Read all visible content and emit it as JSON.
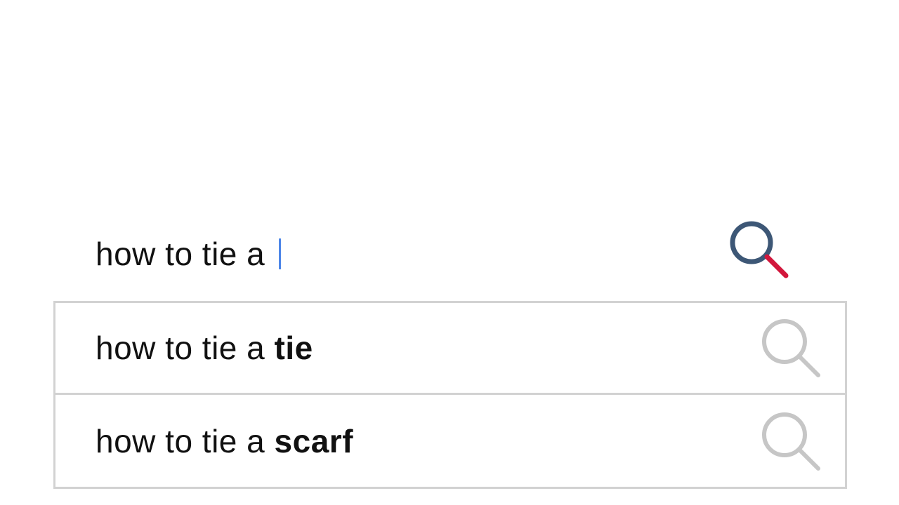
{
  "search": {
    "query": "how to tie a ",
    "colors": {
      "lens": "#3d5776",
      "handle": "#d2173c",
      "caret": "#4d86e8",
      "suggestion_icon": "#c6c6c6",
      "border": "#d2d2d2"
    },
    "button_icon": "magnifier-icon"
  },
  "suggestions": [
    {
      "prefix": "how to tie a ",
      "completion": "tie",
      "icon": "search-icon"
    },
    {
      "prefix": "how to tie a ",
      "completion": "scarf",
      "icon": "search-icon"
    }
  ]
}
